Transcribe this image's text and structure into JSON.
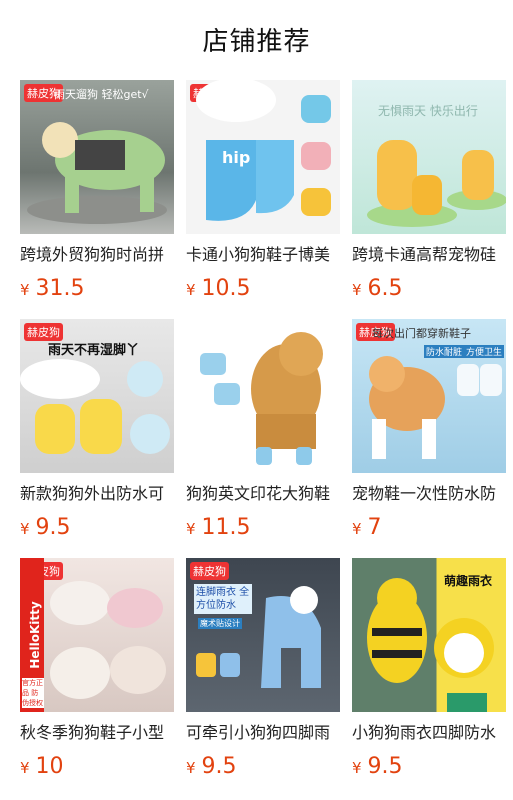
{
  "page_title": "店铺推荐",
  "currency_symbol": "¥",
  "products": [
    {
      "name": "跨境外贸狗狗时尚拼",
      "price": "31.5",
      "overlay": "雨天遛狗 轻松get√",
      "brand_tag": "赫皮狗"
    },
    {
      "name": "卡通小狗狗鞋子博美",
      "price": "10.5",
      "overlay": "hip",
      "brand_tag": "赫皮狗"
    },
    {
      "name": "跨境卡通高帮宠物硅",
      "price": "6.5",
      "overlay": "无惧雨天 快乐出行",
      "brand_tag": ""
    },
    {
      "name": "新款狗狗外出防水可",
      "price": "9.5",
      "overlay": "雨天不再湿脚丫",
      "brand_tag": "赫皮狗"
    },
    {
      "name": "狗狗英文印花大狗鞋",
      "price": "11.5",
      "overlay": "",
      "brand_tag": ""
    },
    {
      "name": "宠物鞋一次性防水防",
      "price": "7",
      "overlay": "每次出门都穿新鞋子",
      "brand_tag": "赫皮狗",
      "badges": [
        "防水耐脏",
        "方便卫生"
      ]
    },
    {
      "name": "秋冬季狗狗鞋子小型",
      "price": "10",
      "overlay": "HelloKitty",
      "brand_tag": "赫皮狗",
      "side_note": "官方正品 防伪授权"
    },
    {
      "name": "可牵引小狗狗四脚雨",
      "price": "9.5",
      "overlay": "连脚雨衣 全方位防水",
      "brand_tag": "赫皮狗",
      "badges": [
        "魔术贴设计"
      ]
    },
    {
      "name": "小狗狗雨衣四脚防水",
      "price": "9.5",
      "overlay": "萌趣雨衣",
      "brand_tag": ""
    }
  ],
  "colors": {
    "price": "#e2420f",
    "title": "#111111"
  }
}
